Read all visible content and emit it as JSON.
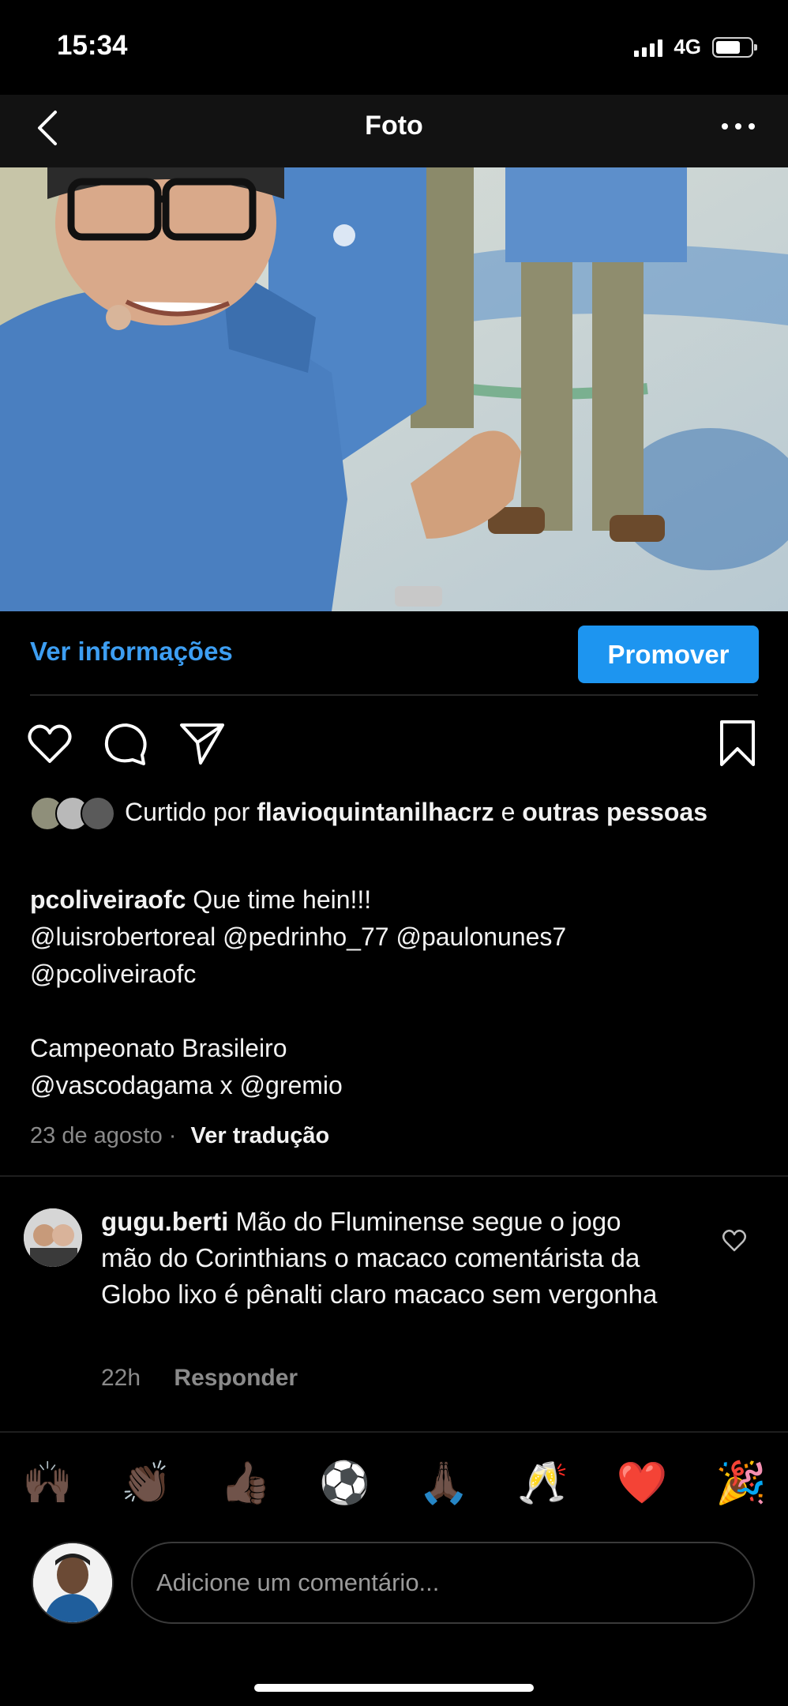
{
  "status_bar": {
    "time": "15:34",
    "network": "4G"
  },
  "nav": {
    "title": "Foto",
    "back_icon": "back-chevron-icon",
    "more_icon": "more-dots-icon"
  },
  "photo": {
    "alt": "photo"
  },
  "info_bar": {
    "info_link": "Ver informações",
    "promote_label": "Promover"
  },
  "actions": {
    "like_icon": "heart-icon",
    "comment_icon": "comment-icon",
    "share_icon": "send-icon",
    "save_icon": "bookmark-icon"
  },
  "likes": {
    "prefix": "Curtido por",
    "user": "flavioquintanilhacrz",
    "connector": "e",
    "others": "outras pessoas"
  },
  "caption": {
    "username": "pcoliveiraofc",
    "text": "Que time hein!!!",
    "mentions_line1": "@luisrobertoreal @pedrinho_77 @paulonunes7",
    "mentions_line2": "@pcoliveiraofc",
    "line3": "Campeonato Brasileiro",
    "line4": "@vascodagama x @gremio",
    "date": "23 de agosto",
    "separator": "·",
    "translate": "Ver tradução"
  },
  "comment": {
    "username": "gugu.berti",
    "text": "Mão do Fluminense segue o jogo mão do Corinthians o macaco comentárista da Globo lixo é pênalti claro macaco sem vergonha",
    "time": "22h",
    "reply": "Responder"
  },
  "emoji_bar": [
    "🙌🏿",
    "👏🏿",
    "👍🏿",
    "⚽",
    "🙏🏿",
    "🥂",
    "❤️",
    "🎉"
  ],
  "comment_box": {
    "placeholder": "Adicione um comentário..."
  },
  "colors": {
    "accent": "#1d95f0",
    "link": "#3d9ef2",
    "background": "#000000",
    "muted": "#8a8a8a"
  }
}
